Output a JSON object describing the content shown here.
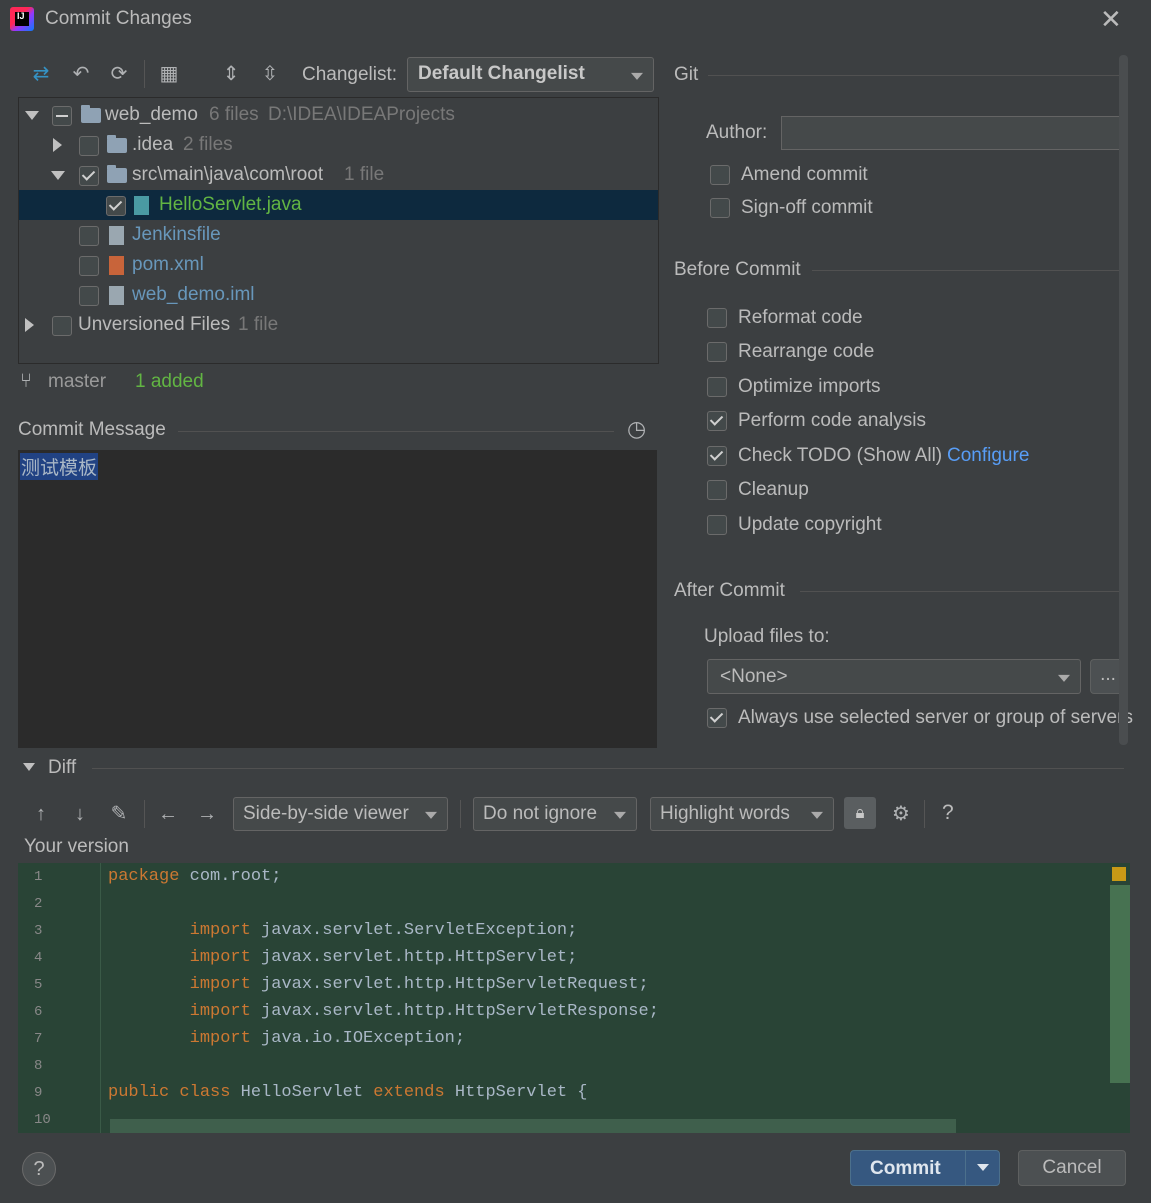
{
  "window": {
    "title": "Commit Changes",
    "close_glyph": "✕"
  },
  "toolbar": {
    "changelist_label": "Changelist:",
    "changelist_value": "Default Changelist",
    "icons": [
      "move-to-changelist-icon",
      "rollback-icon",
      "refresh-icon",
      "group-by-icon",
      "expand-all-icon",
      "collapse-all-icon"
    ]
  },
  "tree": {
    "root": {
      "name": "web_demo",
      "count": "6 files",
      "path": "D:\\IDEA\\IDEAProjects"
    },
    "idea": {
      "name": ".idea",
      "count": "2 files"
    },
    "src": {
      "name": "src\\main\\java\\com\\root",
      "count": "1 file"
    },
    "hello": {
      "name": "HelloServlet.java"
    },
    "jenkins": {
      "name": "Jenkinsfile"
    },
    "pom": {
      "name": "pom.xml"
    },
    "iml": {
      "name": "web_demo.iml"
    },
    "unversioned": {
      "name": "Unversioned Files",
      "count": "1 file"
    }
  },
  "status": {
    "branch": "master",
    "added": "1 added"
  },
  "commit_message": {
    "label": "Commit Message",
    "text": "测试模板"
  },
  "git": {
    "header": "Git",
    "author_label": "Author:",
    "author_value": "",
    "amend": "Amend commit",
    "signoff": "Sign-off commit"
  },
  "before_commit": {
    "header": "Before Commit",
    "reformat": "Reformat code",
    "rearrange": "Rearrange code",
    "optimize": "Optimize imports",
    "analysis": "Perform code analysis",
    "todo": "Check TODO (Show All)",
    "configure": "Configure",
    "cleanup": "Cleanup",
    "copyright": "Update copyright"
  },
  "after_commit": {
    "header": "After Commit",
    "upload_label": "Upload files to:",
    "upload_value": "<None>",
    "browse": "...",
    "always_use": "Always use selected server or group of servers"
  },
  "diff": {
    "header": "Diff",
    "viewer": "Side-by-side viewer",
    "ignore": "Do not ignore",
    "highlight": "Highlight words",
    "help": "?",
    "your_version": "Your version"
  },
  "code": {
    "lines": [
      {
        "n": "1",
        "kw": "package",
        "rest": " com.root;",
        "indent": ""
      },
      {
        "n": "2",
        "kw": "",
        "rest": "",
        "indent": ""
      },
      {
        "n": "3",
        "kw": "import",
        "rest": " javax.servlet.ServletException;",
        "indent": "        "
      },
      {
        "n": "4",
        "kw": "import",
        "rest": " javax.servlet.http.HttpServlet;",
        "indent": "        "
      },
      {
        "n": "5",
        "kw": "import",
        "rest": " javax.servlet.http.HttpServletRequest;",
        "indent": "        "
      },
      {
        "n": "6",
        "kw": "import",
        "rest": " javax.servlet.http.HttpServletResponse;",
        "indent": "        "
      },
      {
        "n": "7",
        "kw": "import",
        "rest": " java.io.IOException;",
        "indent": "        "
      },
      {
        "n": "8",
        "kw": "",
        "rest": "",
        "indent": ""
      },
      {
        "n": "9",
        "kw": "public class",
        "rest": " HelloServlet ",
        "kw2": "extends",
        "rest2": " HttpServlet {",
        "indent": ""
      },
      {
        "n": "10",
        "kw": "",
        "rest": "",
        "indent": ""
      }
    ]
  },
  "buttons": {
    "help": "?",
    "commit": "Commit",
    "cancel": "Cancel"
  }
}
